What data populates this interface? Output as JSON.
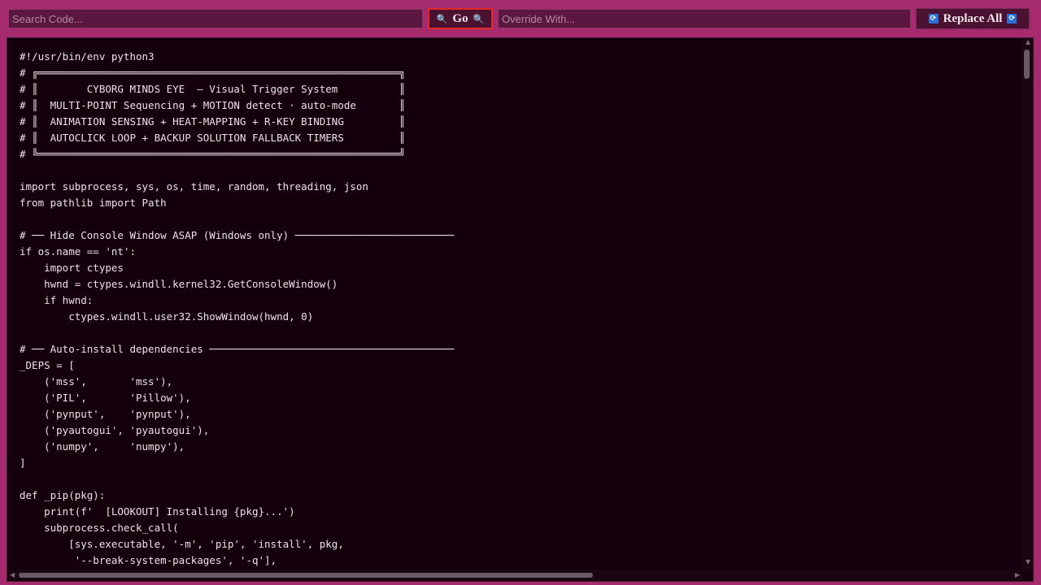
{
  "toolbar": {
    "search_placeholder": "Search Code...",
    "go_label": "Go",
    "go_icon": "🔍",
    "override_placeholder": "Override With...",
    "replace_label": "Replace All",
    "replace_icon": "🔄"
  },
  "editor": {
    "lines": [
      "#!/usr/bin/env python3",
      "# ╔═══════════════════════════════════════════════════════════╗",
      "# ║        CYBORG MINDS EYE  — Visual Trigger System          ║",
      "# ║  MULTI-POINT Sequencing + MOTION detect · auto-mode       ║",
      "# ║  ANIMATION SENSING + HEAT-MAPPING + R-KEY BINDING         ║",
      "# ║  AUTOCLICK LOOP + BACKUP SOLUTION FALLBACK TIMERS         ║",
      "# ╚═══════════════════════════════════════════════════════════╝",
      "",
      "import subprocess, sys, os, time, random, threading, json",
      "from pathlib import Path",
      "",
      "# ── Hide Console Window ASAP (Windows only) ──────────────────────────",
      "if os.name == 'nt':",
      "    import ctypes",
      "    hwnd = ctypes.windll.kernel32.GetConsoleWindow()",
      "    if hwnd:",
      "        ctypes.windll.user32.ShowWindow(hwnd, 0)",
      "",
      "# ── Auto-install dependencies ────────────────────────────────────────",
      "_DEPS = [",
      "    ('mss',       'mss'),",
      "    ('PIL',       'Pillow'),",
      "    ('pynput',    'pynput'),",
      "    ('pyautogui', 'pyautogui'),",
      "    ('numpy',     'numpy'),",
      "]",
      "",
      "def _pip(pkg):",
      "    print(f'  [LOOKOUT] Installing {pkg}...')",
      "    subprocess.check_call(",
      "        [sys.executable, '-m', 'pip', 'install', pkg,",
      "         '--break-system-packages', '-q'],"
    ]
  },
  "colors": {
    "chrome": "#a52a6e",
    "editor_bg": "#14000c",
    "text": "#eee2e8",
    "go_border": "#e02a2a"
  }
}
